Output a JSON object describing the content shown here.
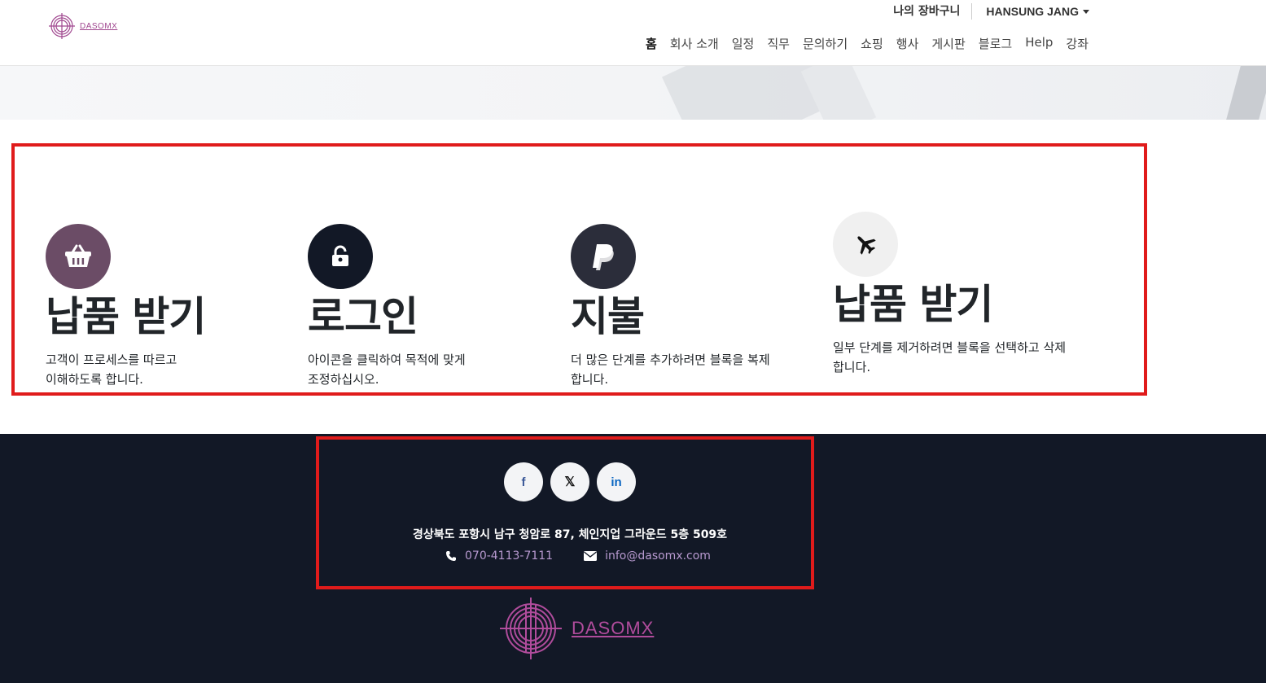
{
  "header": {
    "logo_text": "DASOMX",
    "cart_label": "나의 장바구니",
    "user_name": "HANSUNG JANG",
    "nav": [
      "홈",
      "회사 소개",
      "일정",
      "직무",
      "문의하기",
      "쇼핑",
      "행사",
      "게시판",
      "블로그",
      "Help",
      "강좌"
    ]
  },
  "steps": [
    {
      "icon": "basket-icon",
      "color": "#6b4c66",
      "title": "납품 받기",
      "text_line1": "고객이 프로세스를 따르고",
      "text_line2": "이해하도록 합니다."
    },
    {
      "icon": "unlock-icon",
      "color": "#121826",
      "title": "로그인",
      "text_line1": "아이콘을 클릭하여 목적에 맞게",
      "text_line2": "조정하십시오."
    },
    {
      "icon": "paypal-icon",
      "color": "#2b2d3a",
      "title": "지불",
      "text_line1": "더 많은 단계를 추가하려면 블록을 복제",
      "text_line2": "합니다."
    },
    {
      "icon": "plane-icon",
      "color": "#f0f0f0",
      "title": "납품 받기",
      "text_line1": "일부 단계를 제거하려면 블록을 선택하고 삭제",
      "text_line2": "합니다."
    }
  ],
  "footer": {
    "social": {
      "facebook": "f",
      "x": "𝕏",
      "linkedin": "in"
    },
    "address": "경상북도 포항시 남구 청암로 87, 체인지업 그라운드 5층 509호",
    "phone": "070-4113-7111",
    "email": "info@dasomx.com",
    "logo_text": "DASOMX"
  }
}
